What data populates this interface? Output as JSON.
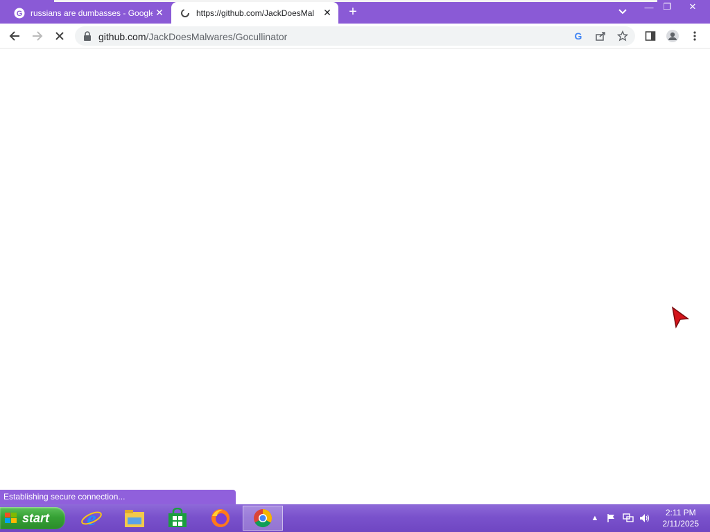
{
  "browser": {
    "tabs": [
      {
        "title": "russians are dumbasses - Google",
        "active": false,
        "favicon": "google-icon"
      },
      {
        "title": "https://github.com/JackDoesMal",
        "active": true,
        "favicon": "github-icon"
      }
    ],
    "new_tab_label": "+",
    "window": {
      "minimize": "—",
      "maximize": "❐",
      "close": "✕"
    },
    "toolbar": {
      "back": "back-arrow-icon",
      "forward": "forward-arrow-icon",
      "stop": "stop-icon",
      "url_host": "github.com",
      "url_path": "/JackDoesMalwares/Gocullinator"
    },
    "status_text": "Establishing secure connection..."
  },
  "taskbar": {
    "start_label": "start",
    "apps": [
      "internet-explorer-icon",
      "file-explorer-icon",
      "store-icon",
      "firefox-icon",
      "chrome-icon"
    ],
    "clock": {
      "time": "2:11 PM",
      "date": "2/11/2025"
    }
  },
  "colors": {
    "accent": "#8a5ad6",
    "taskbar": "#7a52cc",
    "start_green": "#36a135",
    "status_bg": "#9060dc"
  }
}
